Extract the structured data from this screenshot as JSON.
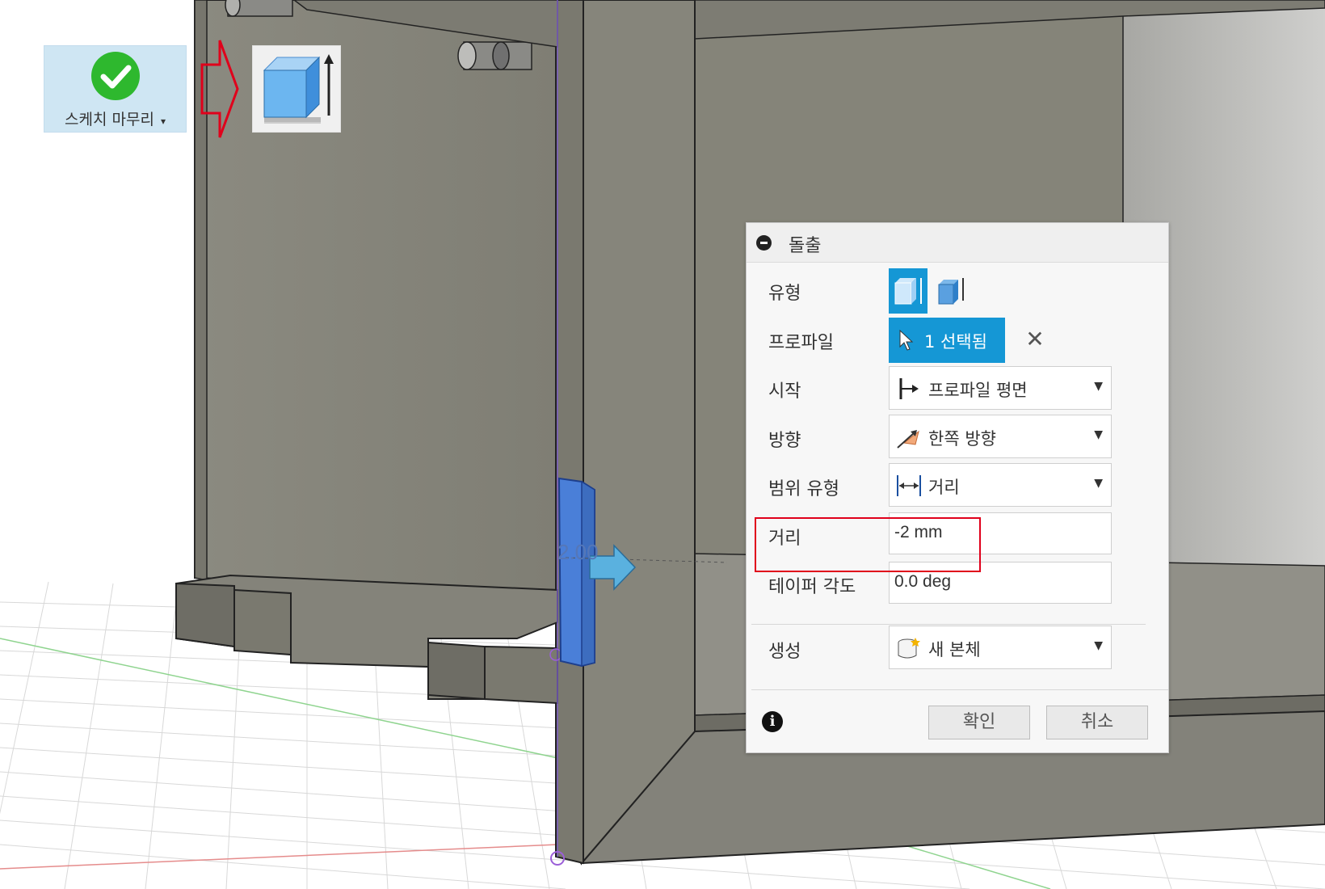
{
  "toolbar": {
    "finish_sketch_label": "스케치 마무리",
    "finish_sketch_caret": "▾",
    "extrude_tool_icon": "extrude-icon"
  },
  "viewport": {
    "dimension_label": "2.00"
  },
  "dialog": {
    "title": "돌출",
    "rows": {
      "type": {
        "label": "유형"
      },
      "profile": {
        "label": "프로파일",
        "selected_text": "1 선택됨",
        "clear": "✕"
      },
      "start": {
        "label": "시작",
        "value": "프로파일 평면"
      },
      "direction": {
        "label": "방향",
        "value": "한쪽 방향"
      },
      "extent_type": {
        "label": "범위 유형",
        "value": "거리"
      },
      "distance": {
        "label": "거리",
        "value": "-2 mm"
      },
      "taper_angle": {
        "label": "테이퍼 각도",
        "value": "0.0 deg"
      },
      "operation": {
        "label": "생성",
        "value": "새 본체"
      }
    },
    "ok_label": "확인",
    "cancel_label": "취소",
    "info_glyph": "i"
  },
  "colors": {
    "accent": "#1597d5",
    "highlight": "#e0001b",
    "check_green": "#2eb82e",
    "model_gray": "#8a8a80"
  }
}
